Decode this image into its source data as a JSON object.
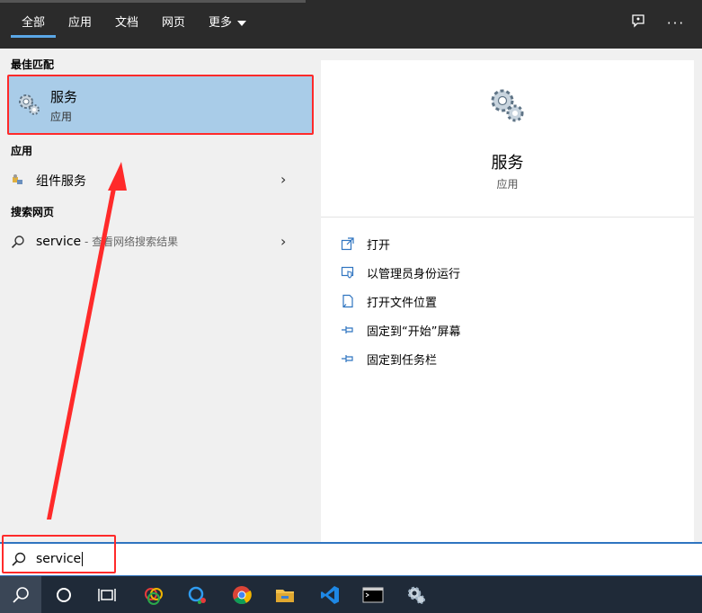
{
  "tabs": [
    {
      "label": "全部",
      "active": true
    },
    {
      "label": "应用",
      "active": false
    },
    {
      "label": "文档",
      "active": false
    },
    {
      "label": "网页",
      "active": false
    },
    {
      "label": "更多",
      "active": false
    }
  ],
  "top_icons": [
    "feedback-icon",
    "more-options-icon"
  ],
  "results": {
    "best_match_header": "最佳匹配",
    "best_match": {
      "title": "服务",
      "subtitle": "应用",
      "icon": "gears-icon"
    },
    "apps_header": "应用",
    "apps": [
      {
        "label": "组件服务",
        "icon": "component-services-icon"
      }
    ],
    "web_header": "搜索网页",
    "web": [
      {
        "label": "service",
        "suffix": " - 查看网络搜索结果",
        "icon": "search-icon"
      }
    ]
  },
  "detail": {
    "title": "服务",
    "subtitle": "应用",
    "actions": [
      {
        "label": "打开",
        "icon": "open-icon"
      },
      {
        "label": "以管理员身份运行",
        "icon": "shield-run-icon"
      },
      {
        "label": "打开文件位置",
        "icon": "file-location-icon"
      },
      {
        "label": "固定到“开始”屏幕",
        "icon": "pin-icon"
      },
      {
        "label": "固定到任务栏",
        "icon": "pin-icon"
      }
    ]
  },
  "search": {
    "value": "service"
  },
  "taskbar": [
    "search-icon",
    "cortana-icon",
    "task-view-icon",
    "app-icon",
    "app-icon",
    "chrome-icon",
    "file-explorer-icon",
    "vscode-icon",
    "terminal-icon",
    "services-icon"
  ],
  "colors": {
    "accent": "#2f74c0",
    "selection": "#a9cce8",
    "annotation": "#ff2a2a",
    "topbar": "#2b2b2b",
    "taskbar": "#1f2a38"
  }
}
